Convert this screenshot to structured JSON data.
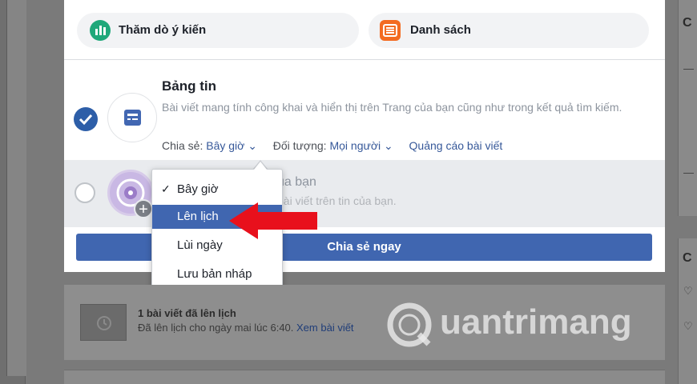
{
  "composer": {
    "poll_label": "Thăm dò ý kiến",
    "list_label": "Danh sách",
    "news_feed": {
      "title": "Bảng tin",
      "description": "Bài viết mang tính công khai và hiển thị trên Trang của bạn cũng như trong kết quả tìm kiếm.",
      "share_prefix": "Chia sẻ:",
      "share_value": "Bây giờ",
      "audience_prefix": "Đối tượng:",
      "audience_value": "Mọi người",
      "boost_link": "Quảng cáo bài viết"
    },
    "story": {
      "title_partial": "ủa bạn",
      "desc_partial": "bài viết trên tin của bạn."
    },
    "share_button": "Chia sẻ ngay"
  },
  "schedule_menu": {
    "items": [
      {
        "label": "Bây giờ",
        "checked": true,
        "highlighted": false
      },
      {
        "label": "Lên lịch",
        "checked": false,
        "highlighted": true
      },
      {
        "label": "Lùi ngày",
        "checked": false,
        "highlighted": false
      },
      {
        "label": "Lưu bản nháp",
        "checked": false,
        "highlighted": false
      }
    ]
  },
  "scheduled_notice": {
    "title": "1 bài viết đã lên lịch",
    "desc": "Đã lên lịch cho ngày mai lúc 6:40.",
    "link": "Xem bài viết"
  },
  "right_panel": {
    "letter1": "C",
    "letter2": "C"
  },
  "watermark": "uantrimang",
  "colors": {
    "accent": "#4066b0",
    "link": "#365899",
    "poll_icon": "#1fa87a",
    "list_icon": "#f36b21",
    "arrow": "#e8101c"
  },
  "icons": [
    "poll-icon",
    "list-icon",
    "news-feed-icon",
    "story-icon",
    "plus-icon",
    "check-icon",
    "chevron-down-icon",
    "clock-icon",
    "pointer-arrow"
  ]
}
